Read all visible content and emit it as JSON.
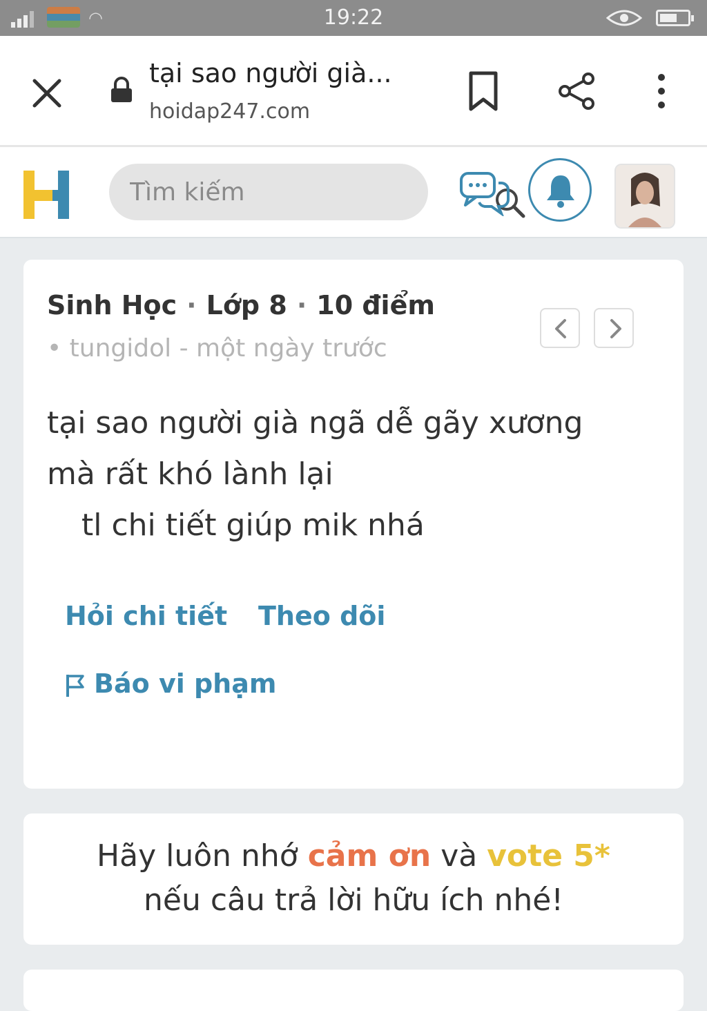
{
  "status_bar": {
    "time": "19:22"
  },
  "browser": {
    "tab_title": "tại sao người già...",
    "url": "hoidap247.com",
    "icons": [
      "close-icon",
      "lock-icon",
      "bookmark-icon",
      "share-icon",
      "more-vert-icon"
    ]
  },
  "header": {
    "logo_letter": "H",
    "search_placeholder": "Tìm kiếm",
    "icons": [
      "search-icon",
      "chat-icon",
      "bell-icon"
    ],
    "colors": {
      "accent": "#3d8ab0",
      "logo_yellow": "#f2c230"
    }
  },
  "question": {
    "subject": "Sinh Học",
    "grade": "Lớp 8",
    "points": "10 điểm",
    "author_line": "• tungidol - một ngày trước",
    "body_line1": "tại sao người già ngã dễ gãy xương",
    "body_line2": "mà rất khó lành lại",
    "body_line3": "tl chi tiết giúp mik nhá",
    "actions": {
      "ask_detail": "Hỏi chi tiết",
      "follow": "Theo dõi",
      "report": "Báo vi phạm"
    }
  },
  "thanks": {
    "part1": "Hãy luôn nhớ ",
    "highlight1": "cảm ơn",
    "part2": " và ",
    "highlight2": "vote 5*",
    "line2": "nếu câu trả lời hữu ích nhé!",
    "colors": {
      "red": "#e8734a",
      "yellow": "#e8c23a"
    }
  }
}
